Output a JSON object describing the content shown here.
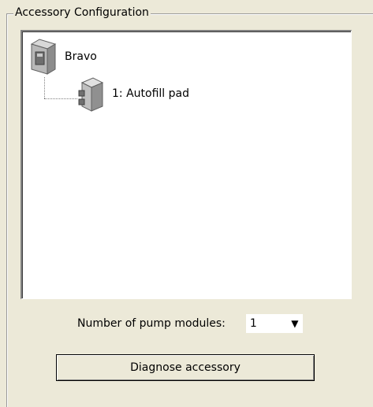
{
  "group": {
    "title": "Accessory Configuration"
  },
  "tree": {
    "root": {
      "label": "Bravo",
      "icon": "robot-base-icon"
    },
    "children": [
      {
        "label": "1: Autofill pad",
        "icon": "pump-module-icon"
      }
    ]
  },
  "pump_modules": {
    "label": "Number of pump modules:",
    "selected": "1"
  },
  "diagnose_button": {
    "label": "Diagnose accessory"
  },
  "colors": {
    "background": "#ece9d8",
    "tree_background": "#ffffff",
    "border_dark": "#808080"
  }
}
